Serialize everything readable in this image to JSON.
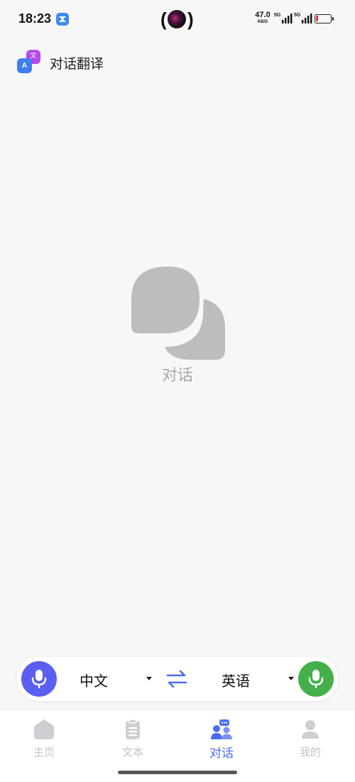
{
  "status_bar": {
    "time": "18:23",
    "net_speed": "47.0",
    "net_speed_unit": "KB/S",
    "signal_1": "5G",
    "signal_2": "5G",
    "battery_level": 0.15,
    "battery_color": "#e53935"
  },
  "header": {
    "logo_back_glyph": "文",
    "logo_front_glyph": "A",
    "title": "对话翻译"
  },
  "empty_state": {
    "icon": "chat-bubbles-icon",
    "label": "对话"
  },
  "language_bar": {
    "source_language": "中文",
    "target_language": "英语",
    "left_mic_color": "#5b5ff0",
    "right_mic_color": "#43b04a",
    "swap_color": "#4a6ef0"
  },
  "bottom_nav": {
    "items": [
      {
        "label": "主页",
        "icon": "home-icon"
      },
      {
        "label": "文本",
        "icon": "document-icon"
      },
      {
        "label": "对话",
        "icon": "conversation-icon",
        "active": true
      },
      {
        "label": "我的",
        "icon": "profile-icon"
      }
    ],
    "active_color": "#4a6ef0",
    "inactive_color": "#c4c4c4"
  }
}
